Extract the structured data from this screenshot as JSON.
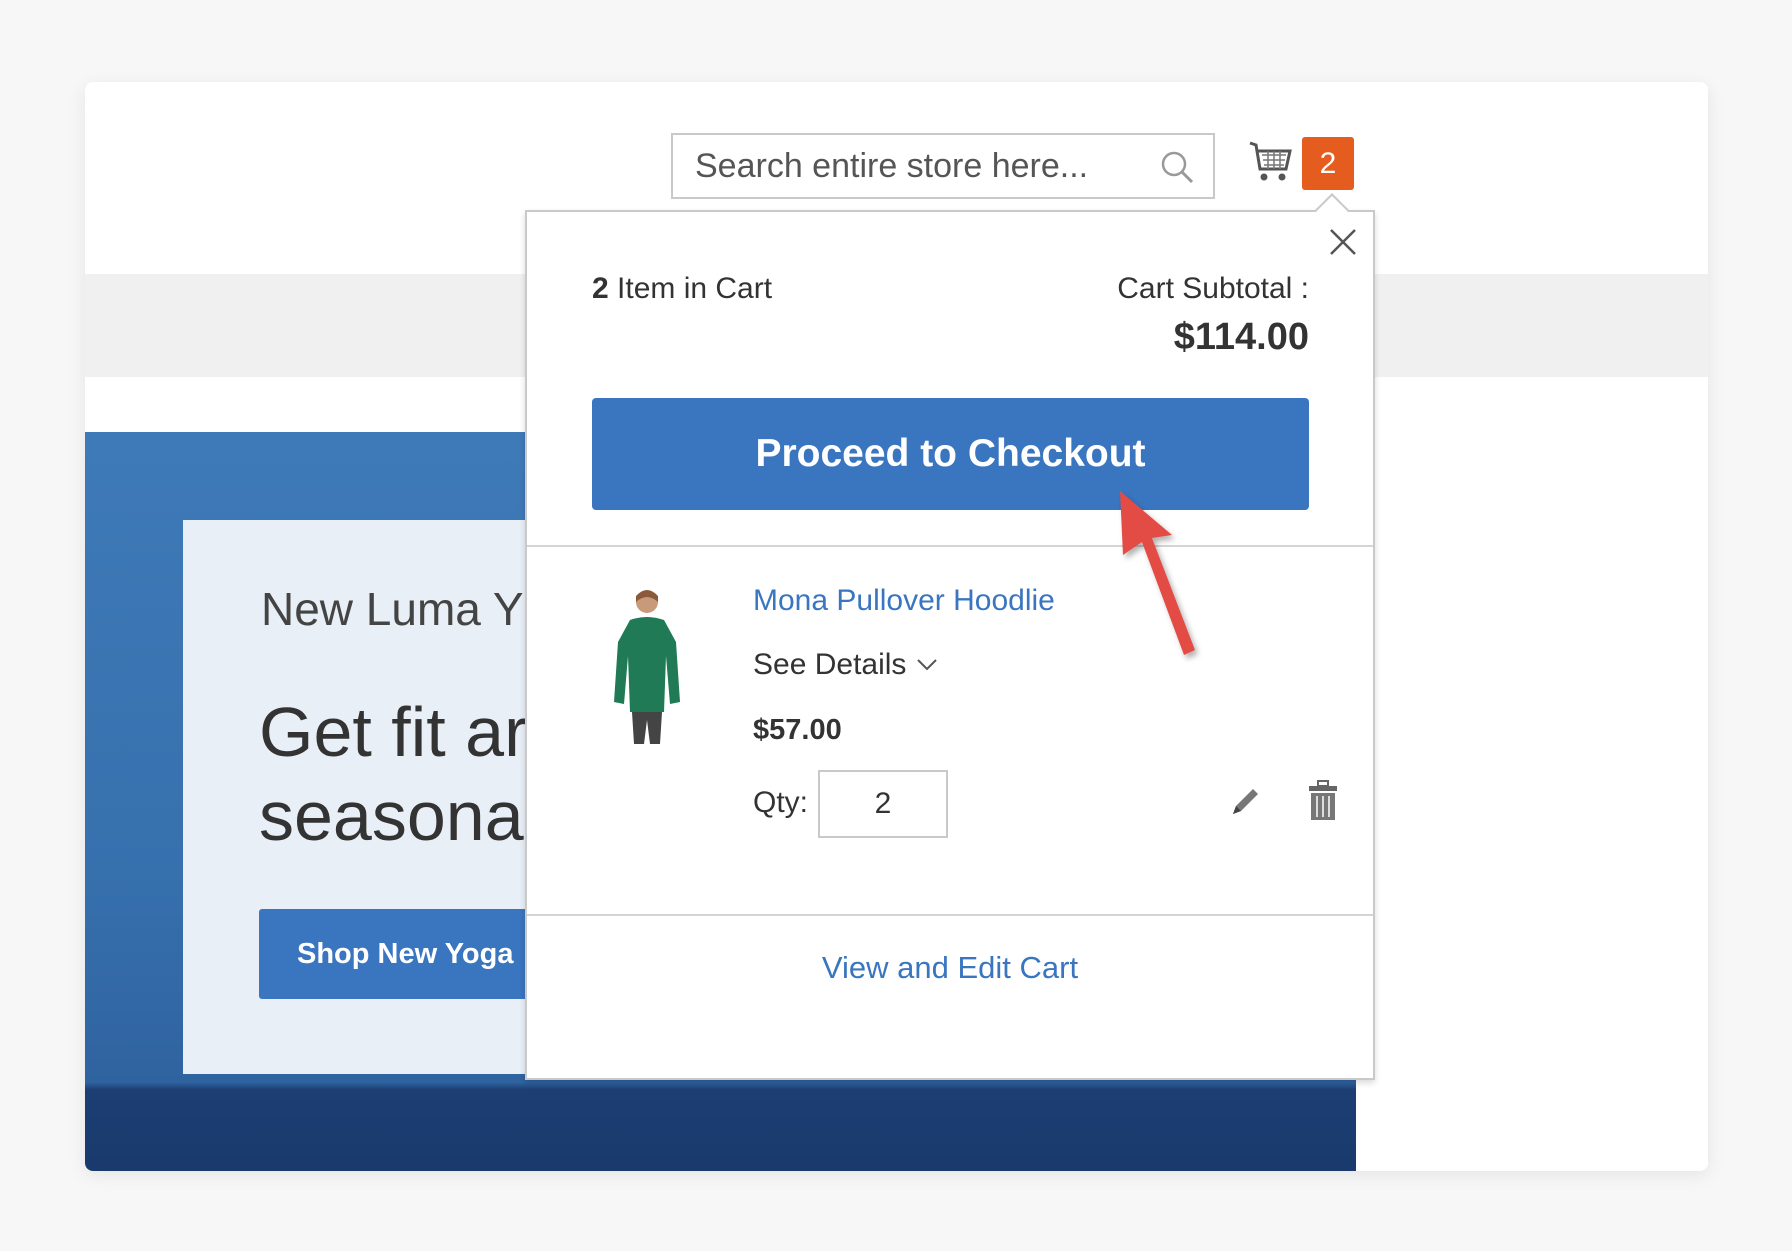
{
  "header": {
    "search_placeholder": "Search entire store here...",
    "cart_count": "2",
    "badge_color": "#e55c1f"
  },
  "hero": {
    "subtitle": "New Luma Y",
    "title": "Get fit ar\nseasona",
    "button_label": "Shop New Yoga"
  },
  "minicart": {
    "item_count": "2",
    "item_count_label": " Item in Cart",
    "subtotal_label": "Cart Subtotal :",
    "subtotal_value": "$114.00",
    "checkout_label": "Proceed to Checkout",
    "accent_color": "#3a75c0",
    "items": [
      {
        "name": "Mona Pullover Hoodlie",
        "details_label": "See Details",
        "price": "$57.00",
        "qty_label": "Qty:",
        "qty": "2"
      }
    ],
    "view_cart_label": "View and Edit Cart"
  },
  "annotation": {
    "arrow_color": "#e34b44"
  }
}
